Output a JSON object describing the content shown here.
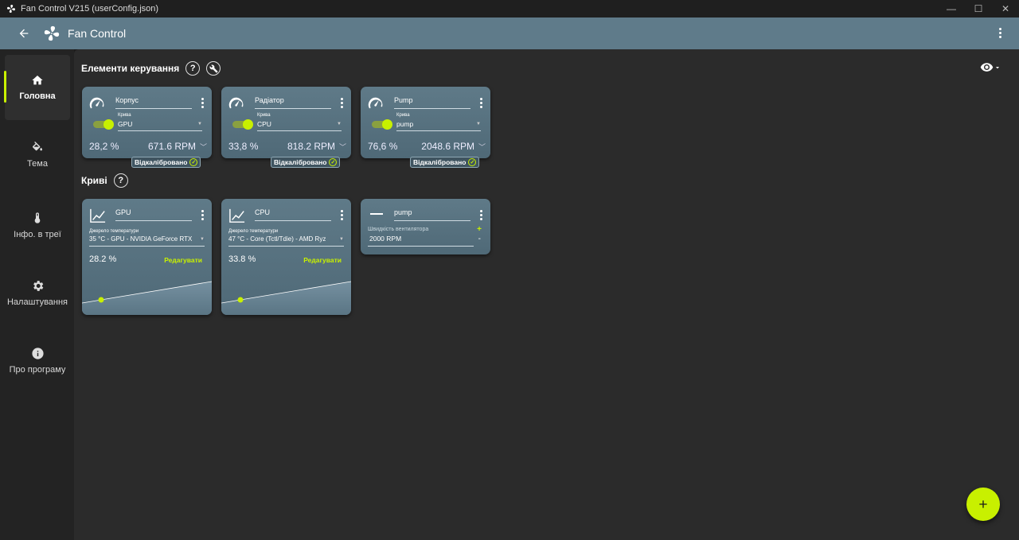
{
  "window": {
    "title": "Fan Control V215 (userConfig.json)"
  },
  "appbar": {
    "title": "Fan Control"
  },
  "sidebar": {
    "items": [
      {
        "label": "Головна",
        "icon": "home-icon",
        "active": true
      },
      {
        "label": "Тема",
        "icon": "paint-bucket-icon"
      },
      {
        "label": "Інфо. в треї",
        "icon": "thermometer-icon"
      },
      {
        "label": "Налаштування",
        "icon": "gear-icon"
      },
      {
        "label": "Про програму",
        "icon": "info-icon"
      }
    ]
  },
  "controls_section": {
    "title": "Елементи керування",
    "help": "?"
  },
  "controls": [
    {
      "name": "Корпус",
      "curve_label": "Крива",
      "curve": "GPU",
      "percent": "28,2 %",
      "rpm": "671.6 RPM",
      "badge": "Відкалібровано",
      "enabled": true
    },
    {
      "name": "Радіатор",
      "curve_label": "Крива",
      "curve": "CPU",
      "percent": "33,8 %",
      "rpm": "818.2 RPM",
      "badge": "Відкалібровано",
      "enabled": true
    },
    {
      "name": "Pump",
      "curve_label": "Крива",
      "curve": "pump",
      "percent": "76,6 %",
      "rpm": "2048.6 RPM",
      "badge": "Відкалібровано",
      "enabled": true
    }
  ],
  "curves_section": {
    "title": "Криві",
    "help": "?"
  },
  "curves": [
    {
      "name": "GPU",
      "source_label": "Джерело температури",
      "source": "35 °C - GPU - NVIDIA GeForce RTX",
      "percent": "28.2 %",
      "edit": "Редагувати",
      "point": 0.282
    },
    {
      "name": "CPU",
      "source_label": "Джерело температури",
      "source": "47 °C - Core (Tctl/Tdie) - AMD Ryz",
      "percent": "33.8 %",
      "edit": "Редагувати",
      "point": 0.338
    }
  ],
  "flat_curve": {
    "name": "pump",
    "speed_label": "Швидкість вентилятора",
    "speed": "2000 RPM",
    "plus": "+",
    "minus": "-"
  },
  "colors": {
    "accent": "#c8f000",
    "card": "#5f7a88",
    "appbar": "#5f7b8a",
    "background": "#2b2b2b"
  }
}
